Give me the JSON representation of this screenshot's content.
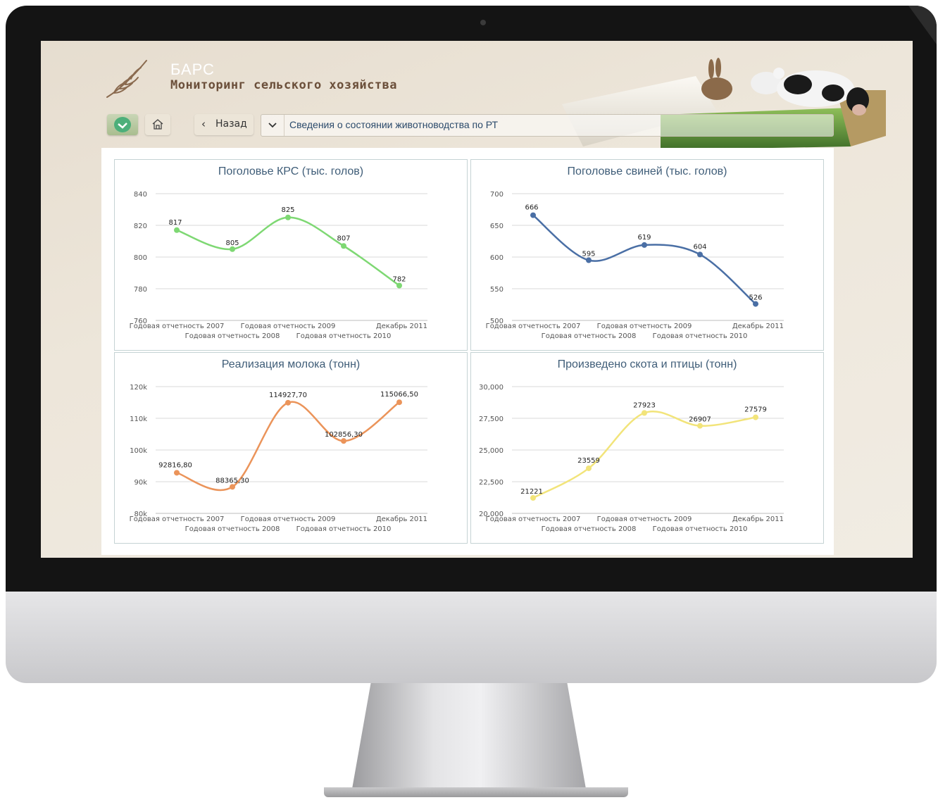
{
  "app": {
    "brand": "БАРС",
    "subtitle": "Мониторинг сельского хозяйства"
  },
  "toolbar": {
    "back_label": "Назад",
    "report_selected": "Сведения о состоянии животноводства по РТ"
  },
  "icons": {
    "check": "check-icon",
    "home": "home-icon",
    "back": "chevron-left-icon",
    "dropdown": "chevron-down-icon"
  },
  "chart_data": [
    {
      "type": "line",
      "title": "Поголовье КРС (тыс. голов)",
      "categories": [
        "Годовая отчетность 2007",
        "Годовая отчетность 2008",
        "Годовая отчетность 2009",
        "Годовая отчетность 2010",
        "Декабрь 2011"
      ],
      "values": [
        817,
        805,
        825,
        807,
        782
      ],
      "value_labels": [
        "817",
        "805",
        "825",
        "807",
        "782"
      ],
      "yticks": [
        "840",
        "820",
        "800",
        "780",
        "760"
      ],
      "ylim": [
        760,
        840
      ],
      "color": "#7ed873",
      "grid": true
    },
    {
      "type": "line",
      "title": "Поголовье свиней (тыс. голов)",
      "categories": [
        "Годовая отчетность 2007",
        "Годовая отчетность 2008",
        "Годовая отчетность 2009",
        "Годовая отчетность 2010",
        "Декабрь 2011"
      ],
      "values": [
        666,
        595,
        619,
        604,
        526
      ],
      "value_labels": [
        "666",
        "595",
        "619",
        "604",
        "526"
      ],
      "yticks": [
        "700",
        "650",
        "600",
        "550",
        "500"
      ],
      "ylim": [
        500,
        700
      ],
      "color": "#4a6fa5",
      "grid": true
    },
    {
      "type": "line",
      "title": "Реализация молока (тонн)",
      "categories": [
        "Годовая отчетность 2007",
        "Годовая отчетность 2008",
        "Годовая отчетность 2009",
        "Годовая отчетность 2010",
        "Декабрь 2011"
      ],
      "values": [
        92816.8,
        88365.3,
        114927.7,
        102856.3,
        115066.5
      ],
      "value_labels": [
        "92816,80",
        "88365,30",
        "114927,70",
        "102856,30",
        "115066,50"
      ],
      "yticks": [
        "120k",
        "110k",
        "100k",
        "90k",
        "80k"
      ],
      "ylim": [
        80000,
        120000
      ],
      "color": "#eb945a",
      "grid": true
    },
    {
      "type": "line",
      "title": "Произведено скота и птицы (тонн)",
      "categories": [
        "Годовая отчетность 2007",
        "Годовая отчетность 2008",
        "Годовая отчетность 2009",
        "Годовая отчетность 2010",
        "Декабрь 2011"
      ],
      "values": [
        21221,
        23559,
        27923,
        26907,
        27579
      ],
      "value_labels": [
        "21221",
        "23559",
        "27923",
        "26907",
        "27579"
      ],
      "yticks": [
        "30,000",
        "27,500",
        "25,000",
        "22,500",
        "20,000"
      ],
      "ylim": [
        20000,
        30000
      ],
      "color": "#f2e47a",
      "grid": true
    }
  ]
}
